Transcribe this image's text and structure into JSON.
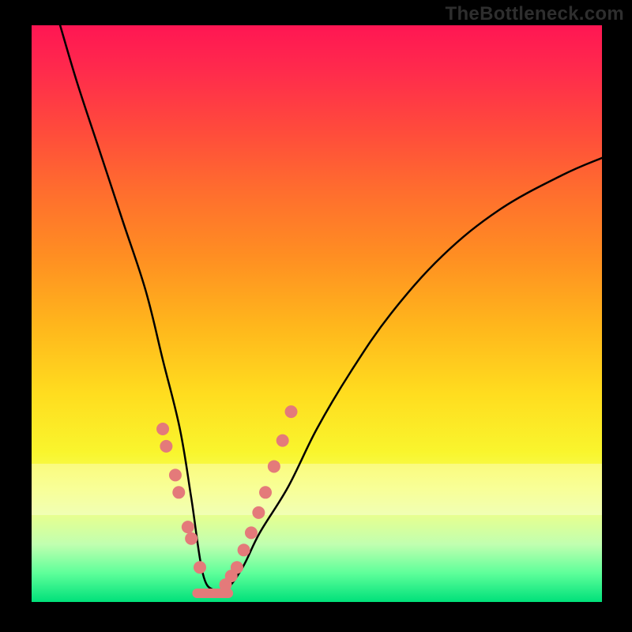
{
  "watermark": "TheBottleneck.com",
  "chart_data": {
    "type": "line",
    "title": "",
    "xlabel": "",
    "ylabel": "",
    "xlim": [
      0,
      100
    ],
    "ylim": [
      0,
      100
    ],
    "grid": false,
    "legend": false,
    "curve": {
      "comment": "V-shaped bottleneck curve: left branch steep descent, minimum near x≈30, right branch slow climb. x in 0–100, y in 0–100 (100=top).",
      "x": [
        5,
        8,
        12,
        16,
        20,
        23,
        26,
        28,
        30,
        32,
        34,
        37,
        40,
        45,
        50,
        56,
        63,
        72,
        82,
        93,
        100
      ],
      "y": [
        100,
        90,
        78,
        66,
        54,
        42,
        30,
        18,
        5,
        2,
        2,
        6,
        12,
        20,
        30,
        40,
        50,
        60,
        68,
        74,
        77
      ]
    },
    "highlight_dots_left": {
      "comment": "salmon dots on left branch near bottom",
      "x": [
        23.0,
        23.6,
        25.2,
        25.8,
        27.4,
        28.0,
        29.5
      ],
      "y": [
        30.0,
        27.0,
        22.0,
        19.0,
        13.0,
        11.0,
        6.0
      ]
    },
    "highlight_dots_right": {
      "comment": "salmon dots on right branch near bottom",
      "x": [
        34.0,
        35.0,
        36.0,
        37.2,
        38.5,
        39.8,
        41.0,
        42.5,
        44.0,
        45.5
      ],
      "y": [
        3.0,
        4.5,
        6.0,
        9.0,
        12.0,
        15.5,
        19.0,
        23.5,
        28.0,
        33.0
      ]
    },
    "flat_min_segment": {
      "comment": "salmon horizontal segment at very bottom between branches",
      "x0": 29.0,
      "x1": 34.5,
      "y": 1.5
    },
    "gradient_stops": [
      {
        "pos": 0.0,
        "color": "#ff1653"
      },
      {
        "pos": 0.2,
        "color": "#ff5a36"
      },
      {
        "pos": 0.45,
        "color": "#ff9a20"
      },
      {
        "pos": 0.65,
        "color": "#ffe020"
      },
      {
        "pos": 0.8,
        "color": "#f2ff70"
      },
      {
        "pos": 0.92,
        "color": "#9effa8"
      },
      {
        "pos": 1.0,
        "color": "#00e07a"
      }
    ]
  }
}
